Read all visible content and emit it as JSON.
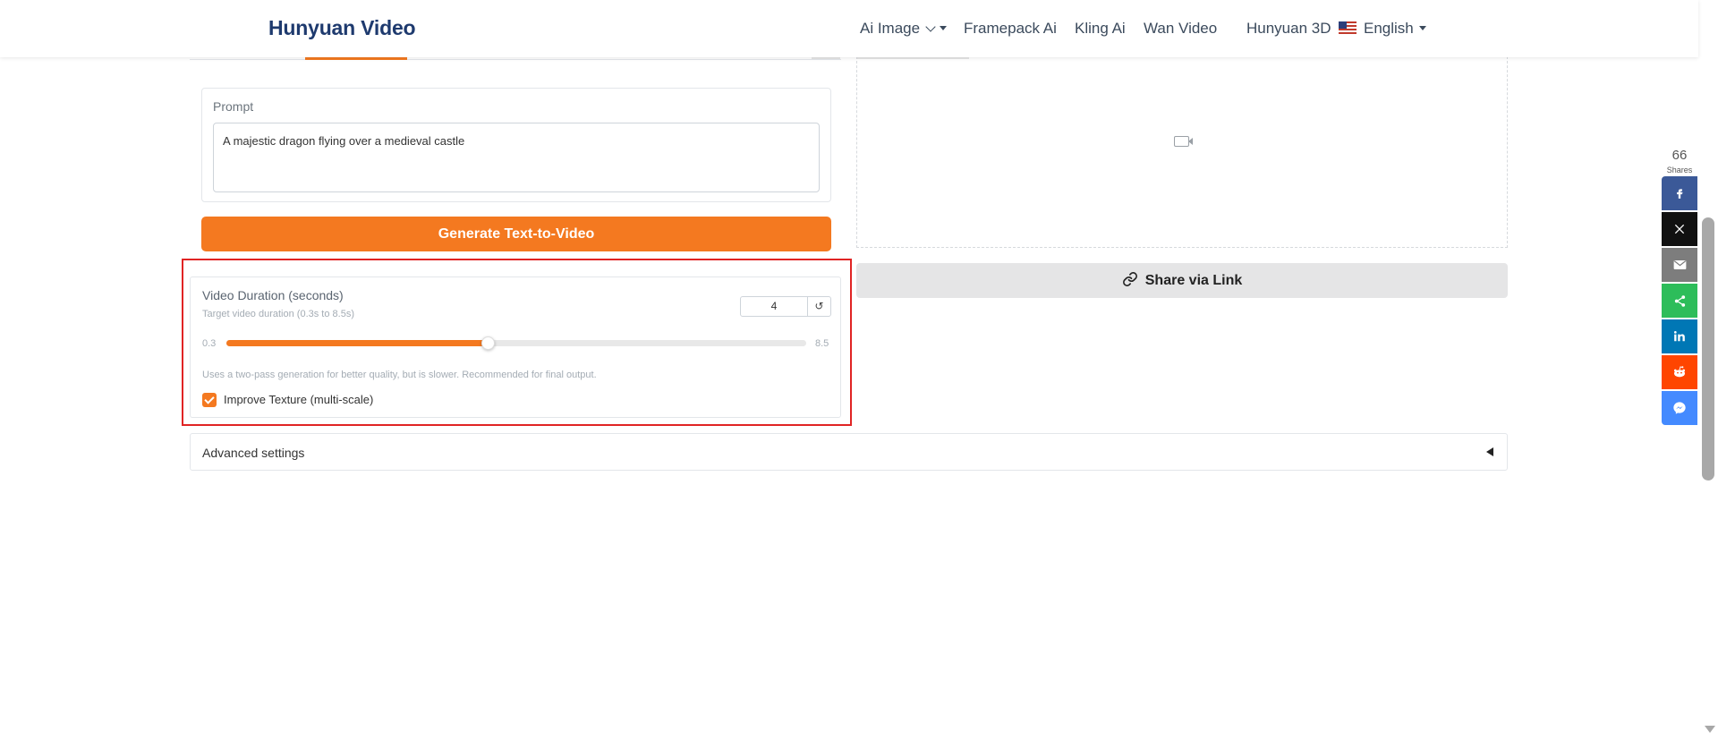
{
  "header": {
    "brand": "Hunyuan Video",
    "nav": {
      "ai_image": "Ai Image",
      "framepack": "Framepack Ai",
      "kling": "Kling Ai",
      "wan": "Wan Video",
      "hunyuan3d": "Hunyuan 3D",
      "language": "English"
    }
  },
  "prompt": {
    "label": "Prompt",
    "value": "A majestic dragon flying over a medieval castle"
  },
  "generate_button": "Generate Text-to-Video",
  "duration": {
    "title": "Video Duration (seconds)",
    "subtitle": "Target video duration (0.3s to 8.5s)",
    "value": "4",
    "reset_symbol": "↺",
    "min_label": "0.3",
    "max_label": "8.5",
    "min": 0.3,
    "max": 8.5,
    "current": 4,
    "note": "Uses a two-pass generation for better quality, but is slower. Recommended for final output.",
    "improve_texture_label": "Improve Texture (multi-scale)",
    "improve_texture_checked": true
  },
  "advanced_settings": "Advanced settings",
  "share_link_button": "Share via Link",
  "social": {
    "count": "66",
    "count_label": "Shares",
    "buttons": [
      "facebook-icon",
      "x-icon",
      "email-icon",
      "share-icon",
      "linkedin-icon",
      "reddit-icon",
      "messenger-icon"
    ]
  },
  "colors": {
    "accent": "#f47920",
    "brand": "#1e3a6e",
    "highlight": "#e02424"
  }
}
